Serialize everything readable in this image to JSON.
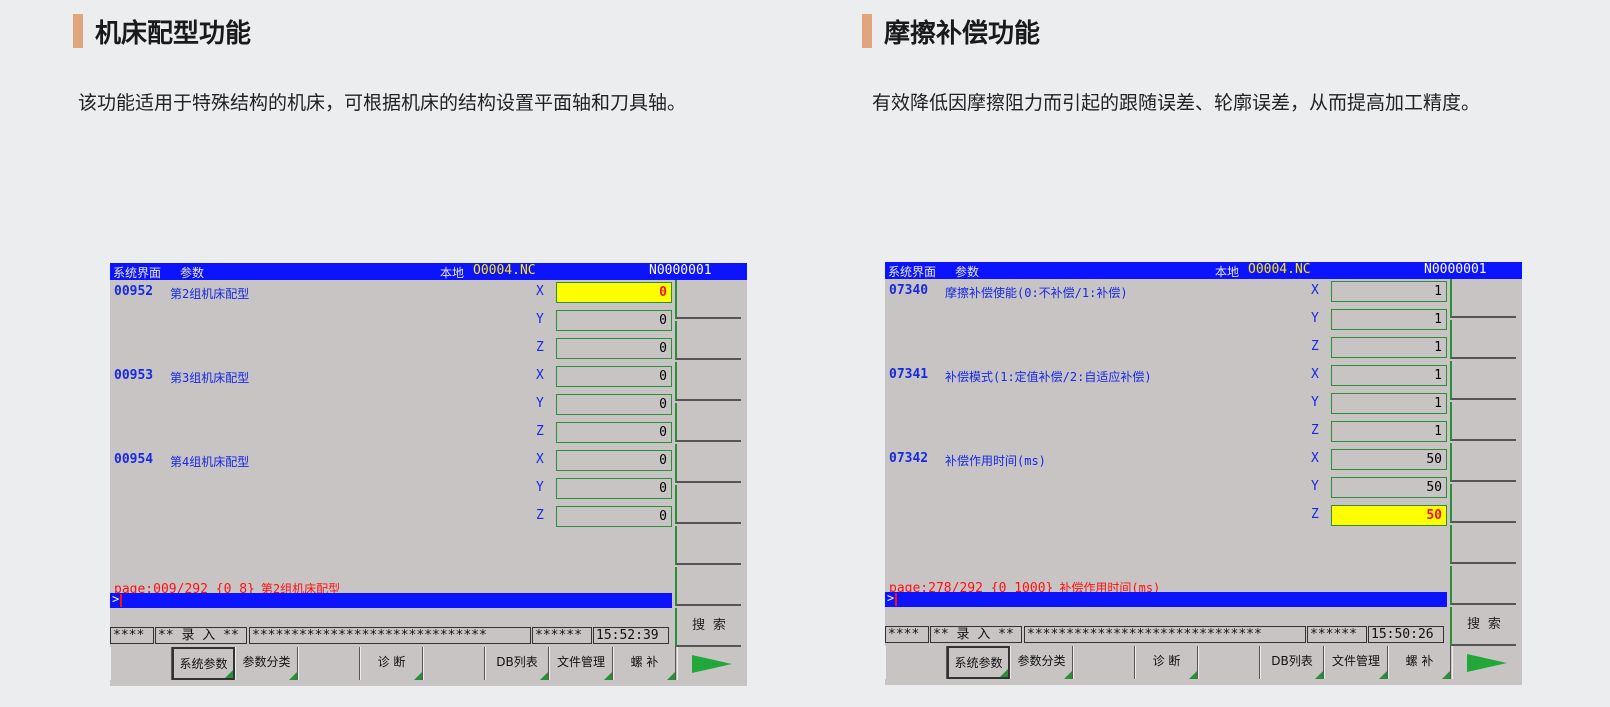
{
  "left": {
    "heading": "机床配型功能",
    "description": "该功能适用于特殊结构的机床，可根据机床的结构设置平面轴和刀具轴。",
    "screen": {
      "topbar": {
        "title": "系统界面",
        "tab": "参数",
        "location_label": "本地",
        "filename": "O0004.NC",
        "block": "N0000001"
      },
      "params": [
        {
          "code": "00952",
          "name": "第2组机床配型"
        },
        {
          "code": "00953",
          "name": "第3组机床配型"
        },
        {
          "code": "00954",
          "name": "第4组机床配型"
        }
      ],
      "axes": [
        "X",
        "Y",
        "Z",
        "X",
        "Y",
        "Z",
        "X",
        "Y",
        "Z"
      ],
      "values": [
        "0",
        "0",
        "0",
        "0",
        "0",
        "0",
        "0",
        "0",
        "0"
      ],
      "selected_index": 0,
      "page_info": "page:009/292 {0 8}",
      "page_info_name": "第2组机床配型",
      "prompt": ">",
      "search_label": "搜 索",
      "status": {
        "s1": "****",
        "s2": "** 录 入 **",
        "s3": "******************************",
        "s4": "******",
        "time": "15:52:39"
      },
      "fkeys": [
        "系统参数",
        "参数分类",
        "诊 断",
        "DB列表",
        "文件管理",
        "螺 补"
      ]
    }
  },
  "right": {
    "heading": "摩擦补偿功能",
    "description": "有效降低因摩擦阻力而引起的跟随误差、轮廓误差，从而提高加工精度。",
    "screen": {
      "topbar": {
        "title": "系统界面",
        "tab": "参数",
        "location_label": "本地",
        "filename": "O0004.NC",
        "block": "N0000001"
      },
      "params": [
        {
          "code": "07340",
          "name": "摩擦补偿使能(0:不补偿/1:补偿)"
        },
        {
          "code": "07341",
          "name": "补偿模式(1:定值补偿/2:自适应补偿)"
        },
        {
          "code": "07342",
          "name": "补偿作用时间(ms)"
        }
      ],
      "axes": [
        "X",
        "Y",
        "Z",
        "X",
        "Y",
        "Z",
        "X",
        "Y",
        "Z"
      ],
      "values": [
        "1",
        "1",
        "1",
        "1",
        "1",
        "1",
        "50",
        "50",
        "50"
      ],
      "selected_index": 8,
      "page_info": "page:278/292 {0 1000}",
      "page_info_name": "补偿作用时间(ms)",
      "prompt": ">",
      "search_label": "搜 索",
      "status": {
        "s1": "****",
        "s2": "** 录 入 **",
        "s3": "******************************",
        "s4": "******",
        "time": "15:50:26"
      },
      "fkeys": [
        "系统参数",
        "参数分类",
        "诊 断",
        "DB列表",
        "文件管理",
        "螺 补"
      ]
    }
  }
}
